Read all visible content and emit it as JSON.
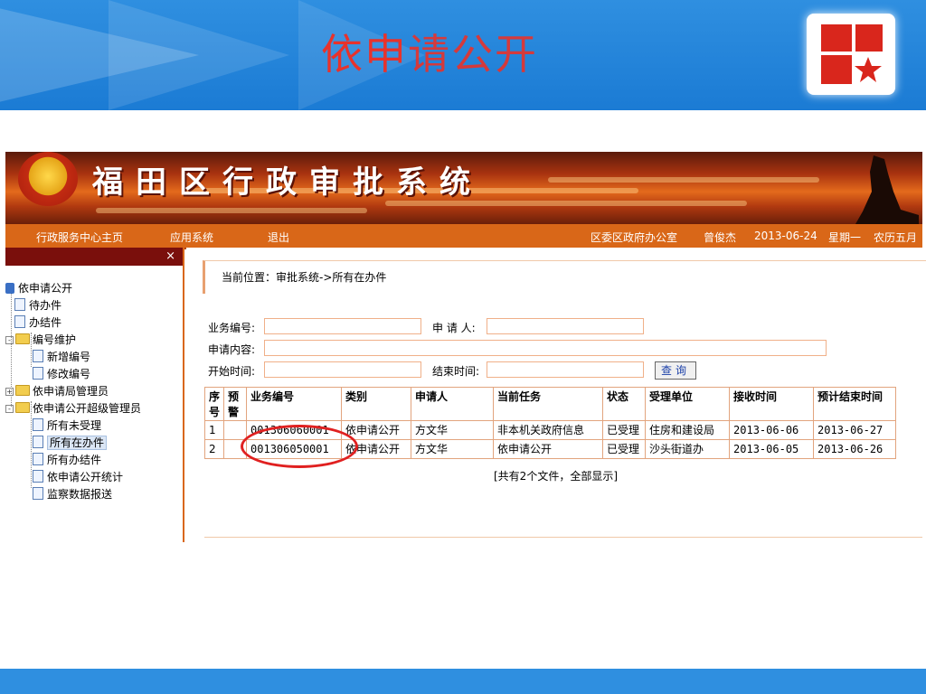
{
  "slide": {
    "title_red": "依申",
    "title_rest": "请公开"
  },
  "app": {
    "system_title": "福田区行政审批系统",
    "nav": {
      "home": "行政服务中心主页",
      "apps": "应用系统",
      "logout": "退出",
      "org": "区委区政府办公室",
      "user": "曾俊杰",
      "date": "2013-06-24",
      "weekday": "星期一",
      "lunar": "农历五月"
    },
    "sidebar": {
      "close": "×",
      "root": "依申请公开",
      "items": [
        "待办件",
        "办结件"
      ],
      "folder_numbering": "编号维护",
      "numbering_items": [
        "新增编号",
        "修改编号"
      ],
      "folder_manager": "依申请局管理员",
      "folder_super": "依申请公开超级管理员",
      "super_items": [
        "所有未受理",
        "所有在办件",
        "所有办结件",
        "依申请公开统计",
        "监察数据报送"
      ]
    },
    "location": "当前位置：审批系统->所有在办件",
    "form": {
      "biz_no": "业务编号:",
      "applicant": "申 请 人:",
      "content": "申请内容:",
      "start": "开始时间:",
      "end": "结束时间:",
      "query": "查询"
    },
    "table": {
      "headers": [
        "序号",
        "预警",
        "业务编号",
        "类别",
        "申请人",
        "当前任务",
        "状态",
        "受理单位",
        "接收时间",
        "预计结束时间"
      ],
      "rows": [
        [
          "1",
          "",
          "001306060001",
          "依申请公开",
          "方文华",
          "非本机关政府信息",
          "已受理",
          "住房和建设局",
          "2013-06-06",
          "2013-06-27"
        ],
        [
          "2",
          "",
          "001306050001",
          "依申请公开",
          "方文华",
          "依申请公开",
          "已受理",
          "沙头街道办",
          "2013-06-05",
          "2013-06-26"
        ]
      ],
      "summary": "[共有2个文件，全部显示]"
    }
  },
  "colors": {
    "header_blue": "#2f8fe0",
    "title_red": "#e8322b",
    "nav_orange": "#d96718",
    "sidebar_dark": "#7a0f0c",
    "highlight_circle": "#e02020"
  },
  "icons": [
    "logo-star-icon",
    "emblem-icon",
    "folder-icon",
    "file-icon",
    "close-icon"
  ]
}
